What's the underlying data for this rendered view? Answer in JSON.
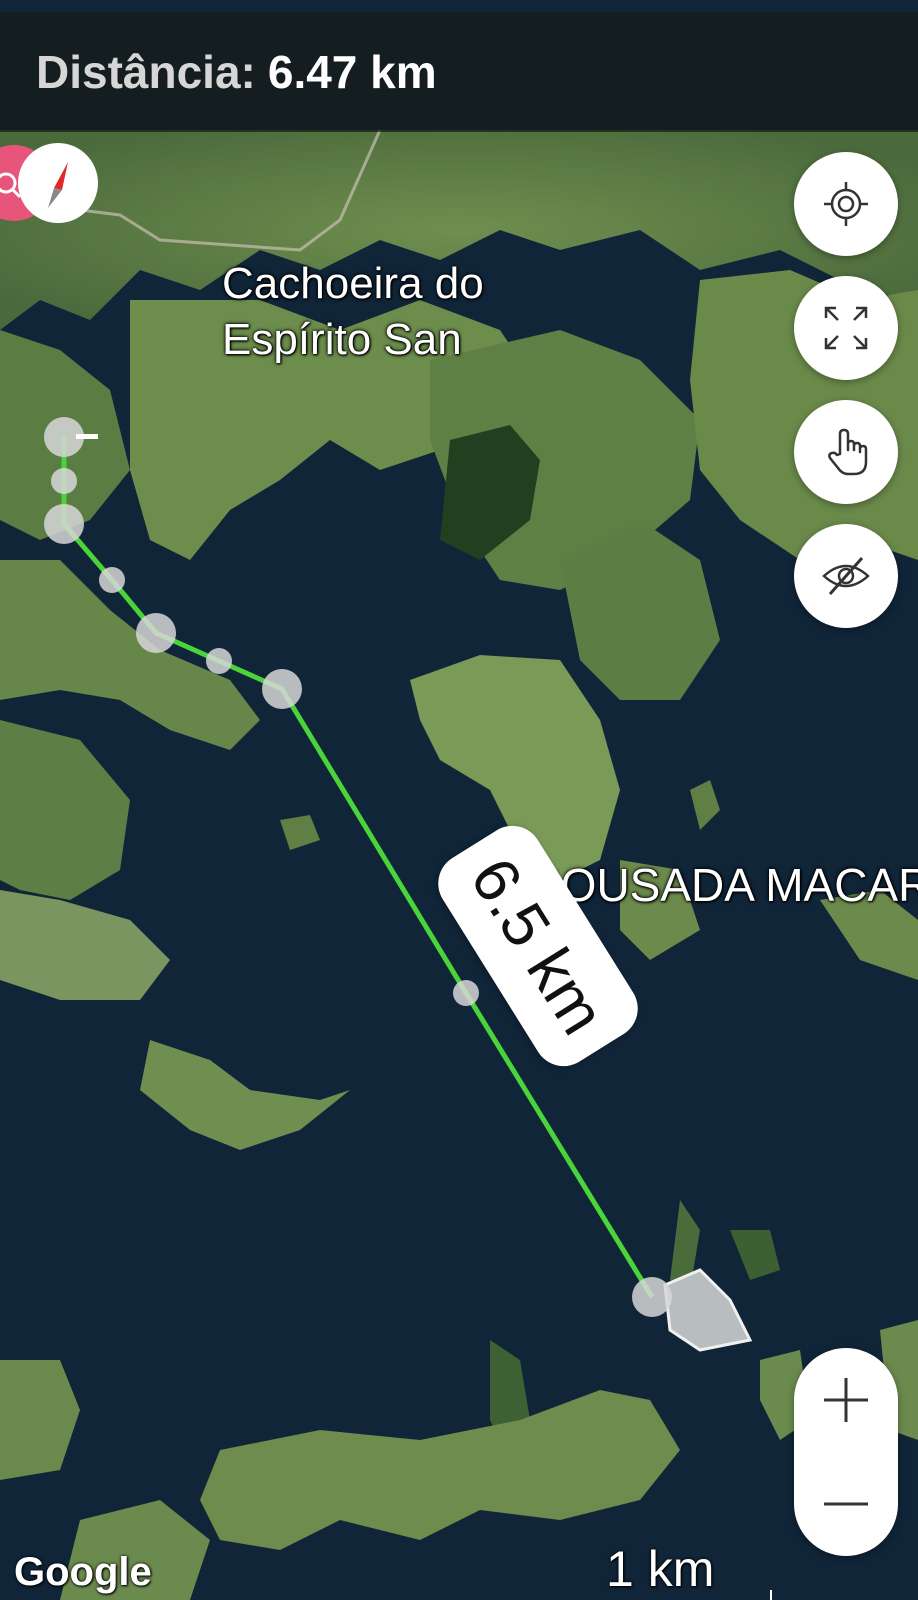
{
  "colors": {
    "accent": "#e8a33a",
    "route": "#49d43a",
    "water": "#0f2236",
    "land": "#5e7e45"
  },
  "header": {
    "distance_label": "Distância:",
    "distance_value": "6.47 km"
  },
  "map": {
    "town_label": "Cachoeira do Espírito San",
    "poi_label": "POUSADA MACAR",
    "segment_distance": "6.5 km",
    "attribution": "Google",
    "scale_label": "1 km"
  },
  "controls": {
    "compass_icon": "compass-icon",
    "my_location_icon": "crosshair-icon",
    "fullscreen_icon": "expand-icon",
    "pan_icon": "hand-pointer-icon",
    "visibility_icon": "eye-off-icon",
    "zoom_in_icon": "plus-icon",
    "zoom_out_icon": "minus-icon"
  }
}
